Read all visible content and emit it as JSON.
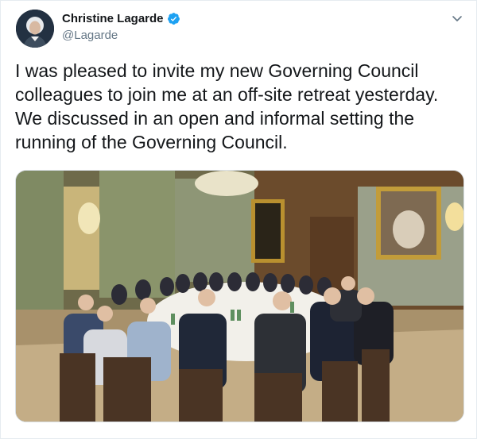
{
  "tweet": {
    "display_name": "Christine Lagarde",
    "handle": "@Lagarde",
    "verified": true,
    "text": "I was pleased to invite my new Governing Council colleagues to join me at an off-site retreat yesterday. We discussed in an open and informal setting the running of the Governing Council.",
    "menu_icon": "chevron-down-icon",
    "verified_icon": "verified-badge-icon"
  },
  "colors": {
    "name_text": "#14171a",
    "handle_text": "#657786",
    "verified_blue": "#1da1f2",
    "border": "#e6ecf0"
  }
}
